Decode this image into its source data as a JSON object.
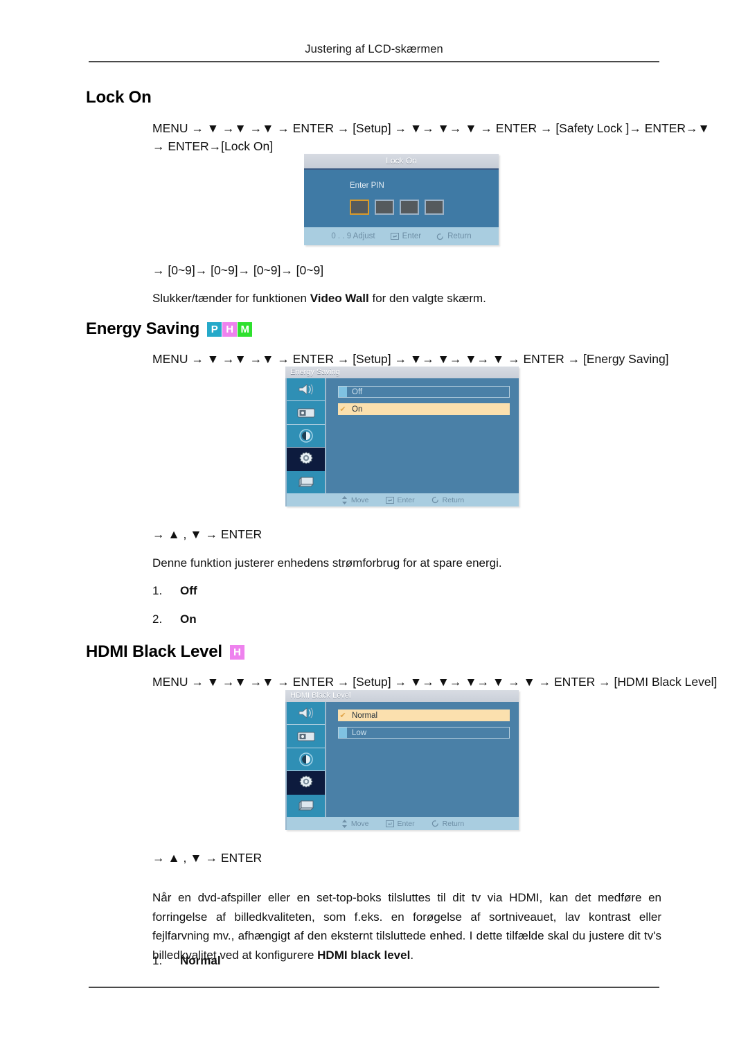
{
  "header": {
    "running_title": "Justering af LCD-skærmen"
  },
  "sections": [
    {
      "id": "lock-on",
      "title": "Lock On",
      "badges": [],
      "path": {
        "prefix": "MENU",
        "segments": [
          "▼",
          "▼",
          "▼"
        ],
        "enter1": "ENTER",
        "bracket1": "Setup",
        "segments2": [
          "▼",
          "▼",
          "▼"
        ],
        "enter2": "ENTER",
        "bracket2": "Safety Lock",
        "enter3": "ENTER",
        "tail_tri": "▼",
        "line2": "→ ENTER→[Lock On]"
      },
      "path_full_line1": "MENU → ▼ →▼ →▼ → ENTER → [Setup] → ▼→ ▼→ ▼ → ENTER → [Safety Lock ]→ ENTER→▼",
      "path_full_line2": "→ ENTER→[Lock On]",
      "after_image_line": "→ [0~9]→ [0~9]→ [0~9]→ [0~9]",
      "description": "Slukker/tænder for funktionen Video Wall for den valgte skærm.",
      "description_bold": "Video Wall",
      "osd": {
        "type": "pin-dialog",
        "title": "Lock On",
        "prompt": "Enter PIN",
        "pin_boxes": 4,
        "selected_box_index": 0,
        "footer": [
          {
            "icon": "digits-icon",
            "label": "0 . . 9  Adjust"
          },
          {
            "icon": "enter-key-icon",
            "label": "Enter"
          },
          {
            "icon": "return-icon",
            "label": "Return"
          }
        ]
      }
    },
    {
      "id": "energy-saving",
      "title": "Energy Saving",
      "badges": [
        "P",
        "H",
        "M"
      ],
      "path_full_line1": "MENU → ▼ →▼ →▼ → ENTER → [Setup] → ▼→ ▼→ ▼→ ▼ → ENTER → [Energy Saving]",
      "after_image_line": "→ ▲ , ▼ → ENTER",
      "description": "Denne funktion justerer enhedens strømforbrug for at spare energi.",
      "options": [
        {
          "num": "1.",
          "label": "Off"
        },
        {
          "num": "2.",
          "label": "On"
        }
      ],
      "osd": {
        "type": "menu",
        "title": "Energy Saving",
        "rail_icons": [
          "sound-icon",
          "picture-icon",
          "contrast-icon",
          "setup-gear-icon",
          "display-icon"
        ],
        "rail_active_index": 3,
        "items": [
          {
            "label": "Off",
            "selected": false
          },
          {
            "label": "On",
            "selected": true
          }
        ],
        "footer": [
          {
            "icon": "move-diamond-icon",
            "label": "Move"
          },
          {
            "icon": "enter-key-icon",
            "label": "Enter"
          },
          {
            "icon": "return-icon",
            "label": "Return"
          }
        ]
      }
    },
    {
      "id": "hdmi-black-level",
      "title": "HDMI Black Level",
      "badges": [
        "H"
      ],
      "path_full_line1": "MENU → ▼ →▼ →▼ → ENTER → [Setup] → ▼→ ▼→ ▼→ ▼ → ▼ → ENTER → [HDMI Black Level]",
      "after_image_line": "→ ▲ , ▼ → ENTER",
      "paragraph_part1": "Når en dvd-afspiller eller en set-top-boks tilsluttes til dit tv via HDMI, kan det medføre en forringelse af billedkvaliteten, som f.eks. en forøgelse af sortniveauet, lav kontrast eller fejlfarvning mv., afhængigt af den eksternt tilsluttede enhed. I dette tilfælde skal du justere dit tv's billedkvalitet ved at konfigurere ",
      "paragraph_bold": "HDMI black level",
      "paragraph_part2": ".",
      "options": [
        {
          "num": "1.",
          "label": "Normal"
        }
      ],
      "osd": {
        "type": "menu",
        "title": "HDMI Black Level",
        "rail_icons": [
          "sound-icon",
          "picture-icon",
          "contrast-icon",
          "setup-gear-icon",
          "display-icon"
        ],
        "rail_active_index": 3,
        "items": [
          {
            "label": "Normal",
            "selected": true
          },
          {
            "label": "Low",
            "selected": false
          }
        ],
        "footer": [
          {
            "icon": "move-diamond-icon",
            "label": "Move"
          },
          {
            "icon": "enter-key-icon",
            "label": "Enter"
          },
          {
            "icon": "return-icon",
            "label": "Return"
          }
        ]
      }
    }
  ],
  "colors": {
    "badge_p": "#25a9c9",
    "badge_h": "#ee82ee",
    "badge_m": "#2ee02e",
    "osd_body": "#4a80a7",
    "osd_selected": "#fbe0ae",
    "osd_rail": "#2f8fb5",
    "osd_rail_active": "#0d1b3e",
    "osd_footer": "#a9cde0"
  }
}
